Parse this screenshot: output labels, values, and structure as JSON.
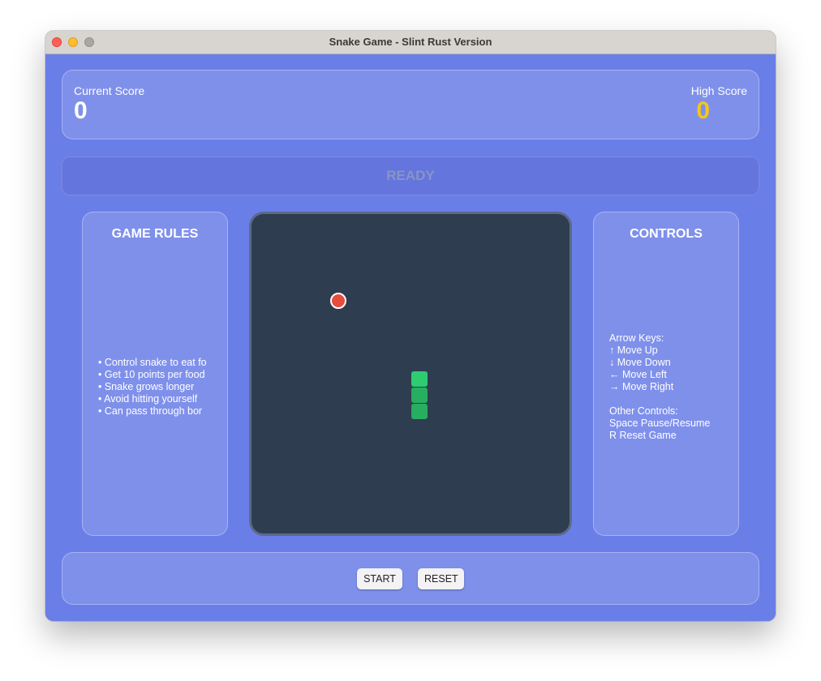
{
  "window": {
    "title": "Snake Game - Slint Rust Version"
  },
  "scores": {
    "current_label": "Current Score",
    "current_value": "0",
    "high_label": "High Score",
    "high_value": "0"
  },
  "status": {
    "text": "READY"
  },
  "rules": {
    "heading": "GAME RULES",
    "items": [
      "• Control snake to eat fo",
      "• Get 10 points per food",
      "• Snake grows longer",
      "• Avoid hitting yourself",
      "• Can pass through bor"
    ]
  },
  "controls_panel": {
    "heading": "CONTROLS",
    "lines": [
      "Arrow Keys:",
      "↑ Move Up",
      "↓ Move Down",
      "← Move Left",
      "→ Move Right",
      "",
      "Other Controls:",
      "Space Pause/Resume",
      "R Reset Game"
    ]
  },
  "game": {
    "food": {
      "col": 5,
      "row": 5
    },
    "snake": [
      {
        "col": 10,
        "row": 10
      },
      {
        "col": 10,
        "row": 11
      },
      {
        "col": 10,
        "row": 12
      }
    ],
    "colors": {
      "board": "#2e3d50",
      "snake_head": "#2ecc71",
      "snake_body": "#27ae60",
      "food": "#e74c3c"
    }
  },
  "buttons": {
    "start_label": "START",
    "reset_label": "RESET"
  },
  "theme": {
    "background": "#6a7ee8",
    "high_score_color": "#f5c518"
  }
}
